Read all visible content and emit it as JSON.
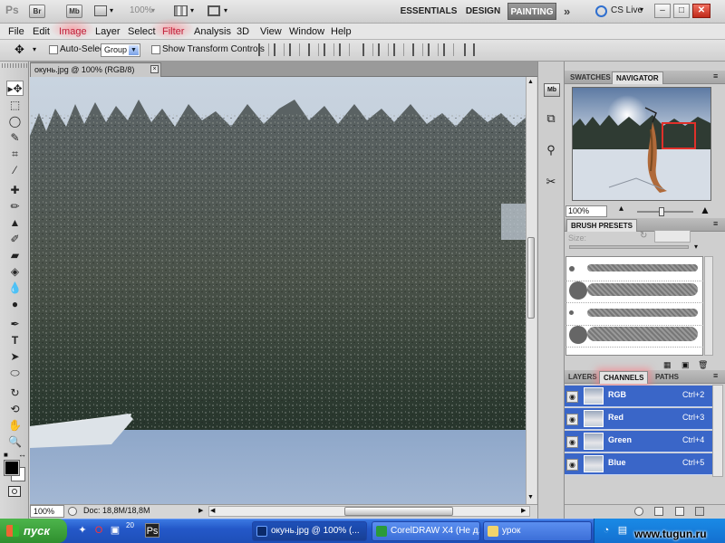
{
  "app": {
    "logo": "Ps",
    "mini_bridge": "Br",
    "mini_mb": "Mb",
    "zoom": "100%",
    "workspaces": [
      "ESSENTIALS",
      "DESIGN",
      "PAINTING"
    ],
    "active_workspace": "PAINTING",
    "cs_live": "CS Live",
    "overflow": "»"
  },
  "menu": [
    "File",
    "Edit",
    "Image",
    "Layer",
    "Select",
    "Filter",
    "Analysis",
    "3D",
    "View",
    "Window",
    "Help"
  ],
  "menu_highlighted": [
    "Image",
    "Filter"
  ],
  "options": {
    "auto_select_label": "Auto-Select:",
    "auto_select_value": "Group",
    "show_transform_label": "Show Transform Controls"
  },
  "tools": [
    "move-tool",
    "marquee-tool",
    "lasso-tool",
    "quick-selection-tool",
    "crop-tool",
    "eyedropper-tool",
    "spot-healing-tool",
    "brush-tool",
    "clone-stamp-tool",
    "history-brush-tool",
    "eraser-tool",
    "gradient-tool",
    "blur-tool",
    "dodge-tool",
    "pen-tool",
    "type-tool",
    "path-selection-tool",
    "shape-tool",
    "3d-rotate-tool",
    "3d-orbit-tool",
    "hand-tool",
    "zoom-tool"
  ],
  "document": {
    "tab_title": "окунь.jpg @ 100% (RGB/8)",
    "zoom_field": "100%",
    "doc_info": "Doc: 18,8M/18,8M"
  },
  "navigator": {
    "tabs": [
      "SWATCHES",
      "NAVIGATOR"
    ],
    "active_tab": "NAVIGATOR",
    "zoom": "100%"
  },
  "brush_presets": {
    "title": "BRUSH PRESETS",
    "size_label": "Size:"
  },
  "layers_panel": {
    "tabs": [
      "LAYERS",
      "CHANNELS",
      "PATHS"
    ],
    "active_tab": "CHANNELS",
    "channels": [
      {
        "name": "RGB",
        "shortcut": "Ctrl+2"
      },
      {
        "name": "Red",
        "shortcut": "Ctrl+3"
      },
      {
        "name": "Green",
        "shortcut": "Ctrl+4"
      },
      {
        "name": "Blue",
        "shortcut": "Ctrl+5"
      }
    ]
  },
  "taskbar": {
    "start_label": "пуск",
    "buttons": [
      "окунь.jpg @ 100% (...",
      "CorelDRAW X4 (Не д...",
      "урок"
    ],
    "tray_number": "20"
  },
  "watermark": "www.tugun.ru",
  "colors": {
    "accent_highlight": "#e0302a",
    "channel_selected": "#3a66c8",
    "taskbar_blue": "#2458c8",
    "start_green": "#2f8f2e"
  }
}
